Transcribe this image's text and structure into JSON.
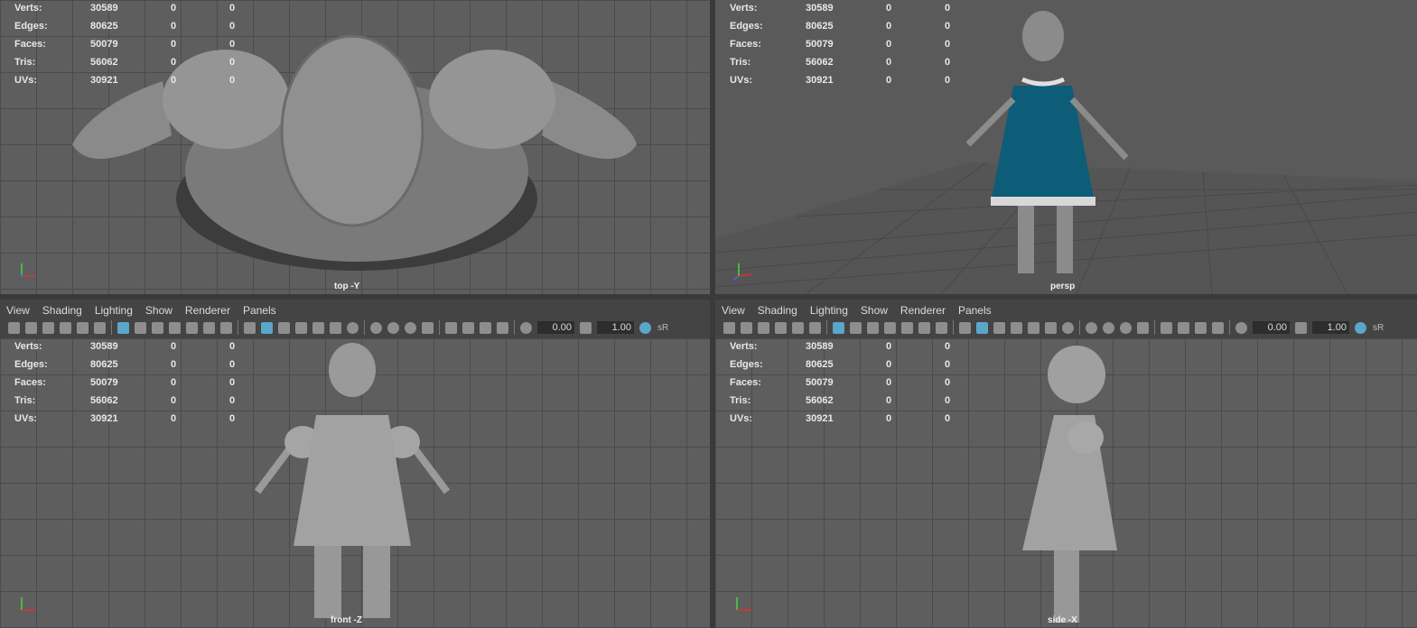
{
  "hud_rows": [
    {
      "label": "Verts:",
      "v1": "30589",
      "v2": "0",
      "v3": "0"
    },
    {
      "label": "Edges:",
      "v1": "80625",
      "v2": "0",
      "v3": "0"
    },
    {
      "label": "Faces:",
      "v1": "50079",
      "v2": "0",
      "v3": "0"
    },
    {
      "label": "Tris:",
      "v1": "56062",
      "v2": "0",
      "v3": "0"
    },
    {
      "label": "UVs:",
      "v1": "30921",
      "v2": "0",
      "v3": "0"
    }
  ],
  "viewports": {
    "top": {
      "camera": "top -Y"
    },
    "persp": {
      "camera": "persp"
    },
    "front": {
      "camera": "front -Z"
    },
    "side": {
      "camera": "side -X"
    }
  },
  "panel_menu": [
    "View",
    "Shading",
    "Lighting",
    "Show",
    "Renderer",
    "Panels"
  ],
  "toolbar": {
    "exposure": "0.00",
    "gamma": "1.00",
    "sr_label": "sR"
  },
  "colors": {
    "viewport_bg": "#5e5e5e",
    "grid": "#4b4b4b",
    "dress": "#0d5c78",
    "panel_bg": "#444444",
    "active_icon": "#5aa7c9"
  }
}
